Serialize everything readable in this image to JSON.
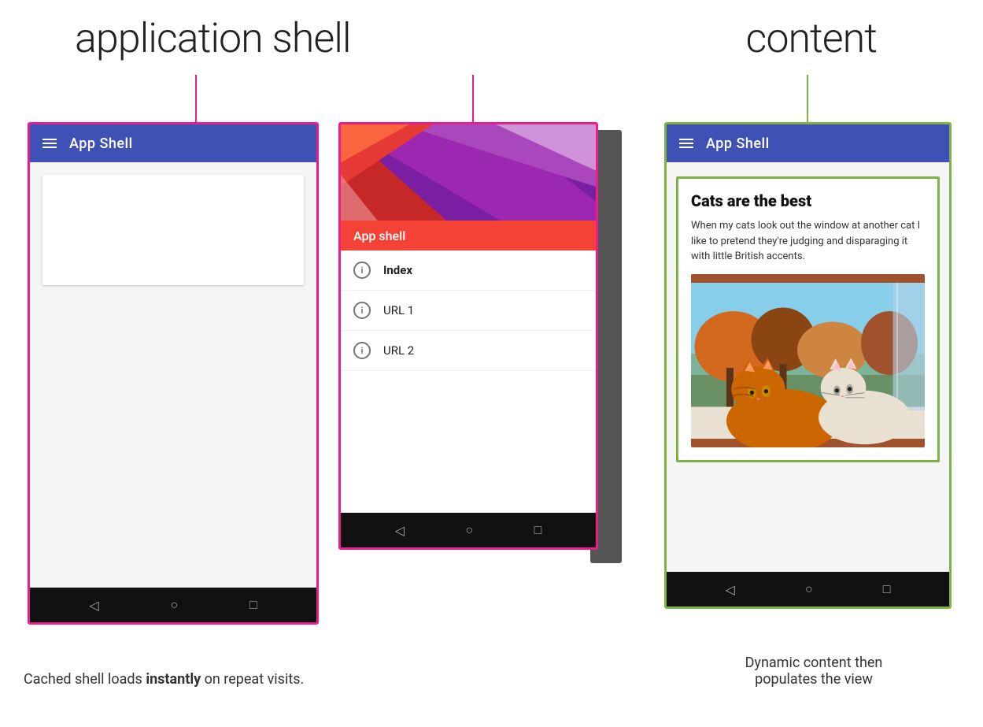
{
  "labels": {
    "app_shell_label": "application shell",
    "content_label": "content"
  },
  "phone1": {
    "app_bar_title": "App Shell",
    "body_type": "empty_card"
  },
  "phone2": {
    "app_shell_overlay": "App shell",
    "menu_items": [
      {
        "label": "Index",
        "bold": true
      },
      {
        "label": "URL 1",
        "bold": false
      },
      {
        "label": "URL 2",
        "bold": false
      }
    ]
  },
  "phone3": {
    "app_bar_title": "App Shell",
    "article": {
      "title": "Cats are the best",
      "body": "When my cats look out the window at another cat I like to pretend they're judging and disparaging it with little British accents."
    }
  },
  "captions": {
    "left": "Cached shell loads instantly on repeat visits.",
    "left_bold": "instantly",
    "right_line1": "Dynamic content then",
    "right_line2": "populates the view"
  },
  "nav": {
    "back": "◁",
    "home": "○",
    "recents": "□"
  }
}
